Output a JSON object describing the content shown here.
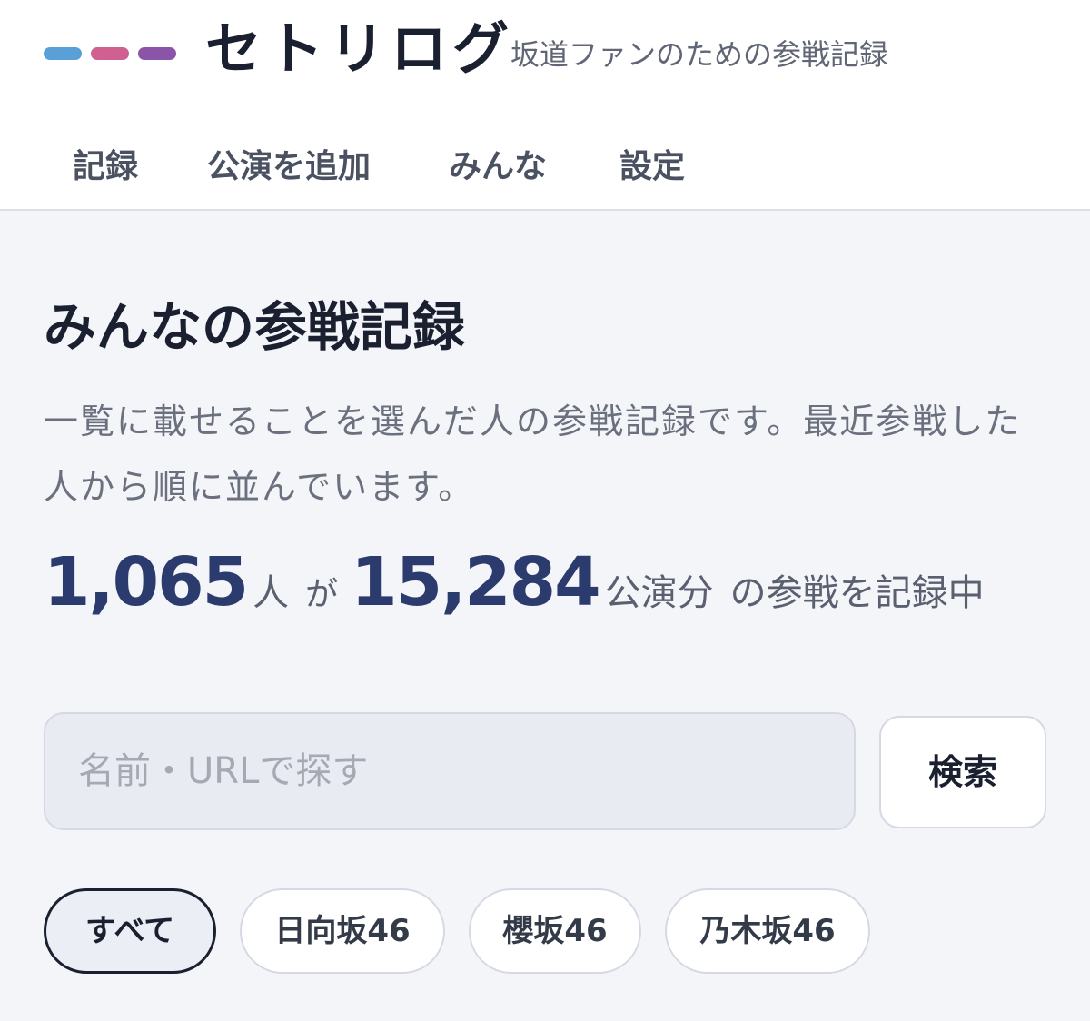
{
  "header": {
    "logo_bar_colors": [
      "#5aa0d8",
      "#d06090",
      "#8a55a8"
    ],
    "brand": "セトリログ",
    "tagline": "坂道ファンのための参戦記録"
  },
  "nav": {
    "items": [
      {
        "label": "記録"
      },
      {
        "label": "公演を追加"
      },
      {
        "label": "みんな"
      },
      {
        "label": "設定"
      }
    ]
  },
  "main": {
    "title": "みんなの参戦記録",
    "description": "一覧に載せることを選んだ人の参戦記録です。最近参戦した人から順に並んでいます。",
    "stats": {
      "people_count": "1,065",
      "people_unit": "人",
      "connector": "が",
      "shows_count": "15,284",
      "shows_unit": "公演分",
      "suffix": "の参戦を記録中"
    },
    "search": {
      "placeholder": "名前・URLで探す",
      "button_label": "検索"
    },
    "filters": [
      {
        "label": "すべて",
        "active": true
      },
      {
        "label": "日向坂46",
        "active": false
      },
      {
        "label": "櫻坂46",
        "active": false
      },
      {
        "label": "乃木坂46",
        "active": false
      }
    ]
  }
}
